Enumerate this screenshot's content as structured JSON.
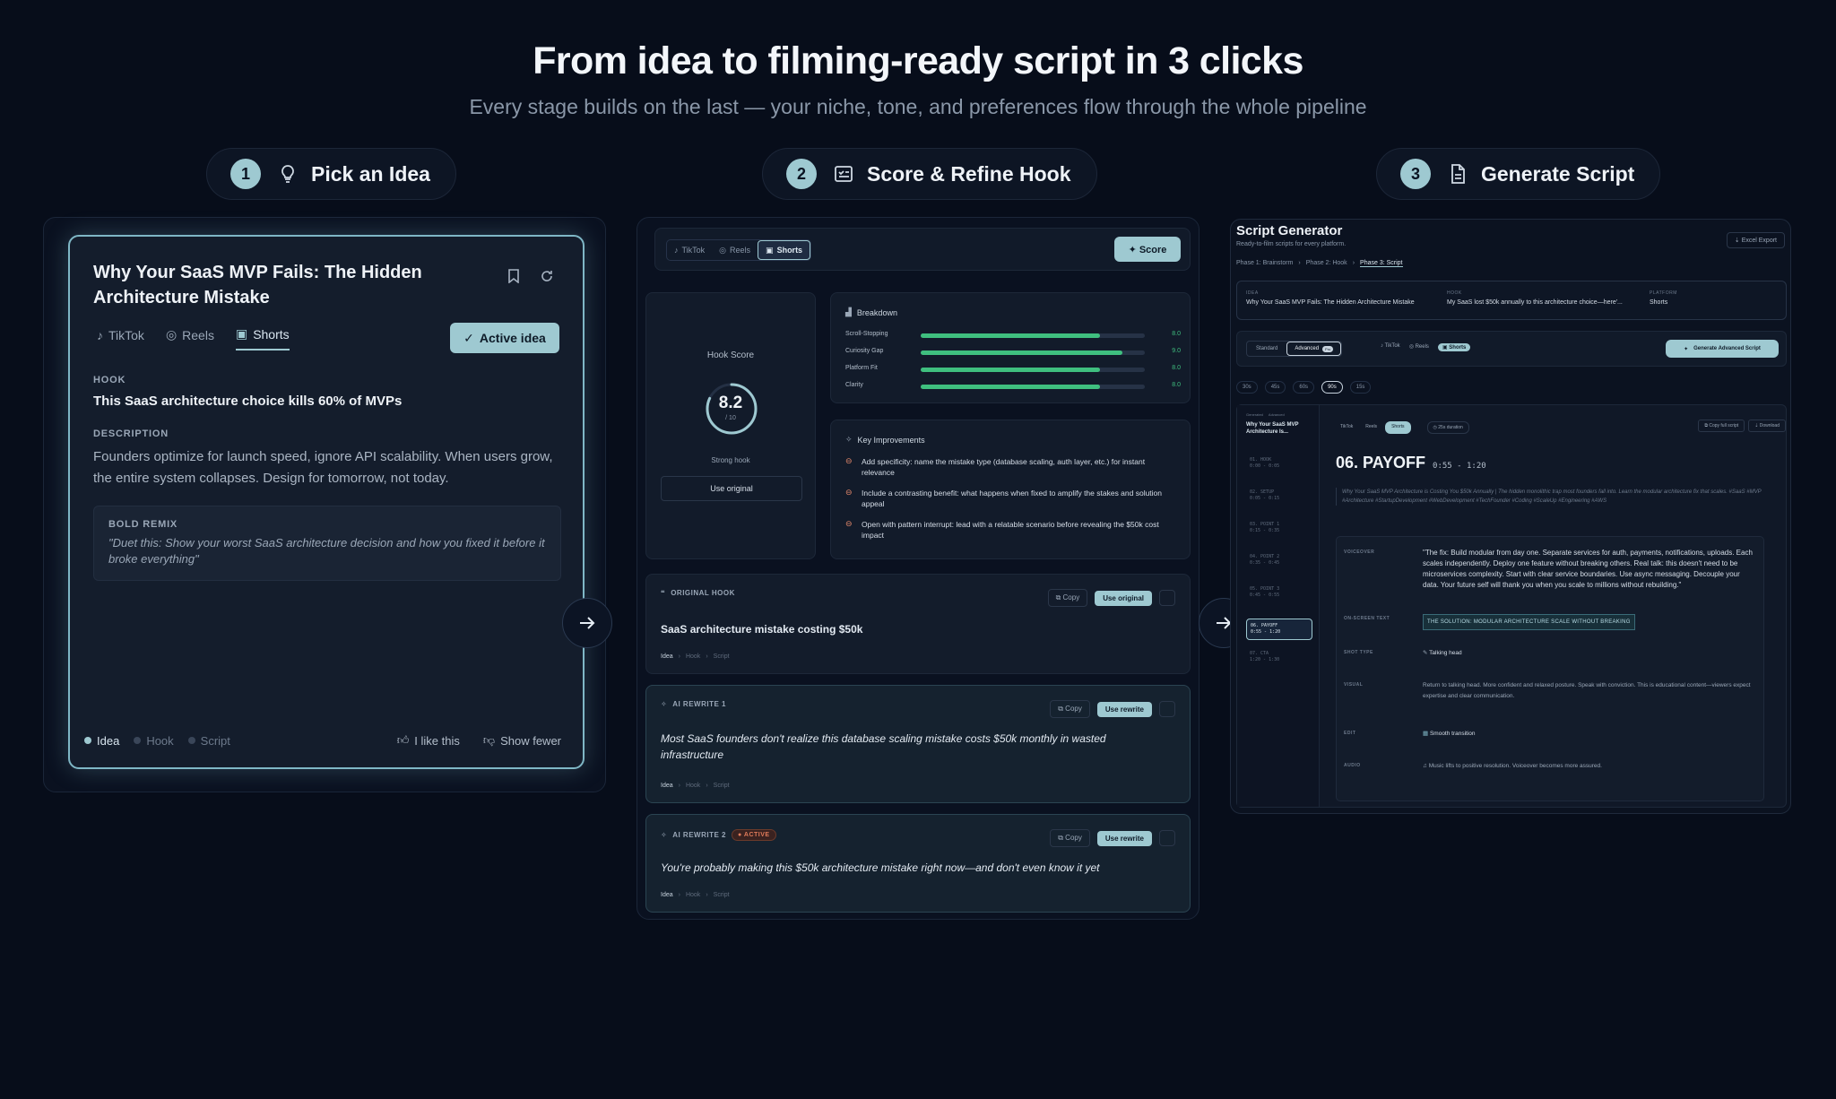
{
  "hero": {
    "title": "From idea to filming-ready script in 3 clicks",
    "subtitle": "Every stage builds on the last — your niche, tone, and preferences flow through the whole pipeline"
  },
  "steps": [
    {
      "num": "1",
      "label": "Pick an Idea",
      "icon": "lightbulb-icon"
    },
    {
      "num": "2",
      "label": "Score & Refine Hook",
      "icon": "checklist-icon"
    },
    {
      "num": "3",
      "label": "Generate Script",
      "icon": "document-icon"
    }
  ],
  "idea_card": {
    "title": "Why Your SaaS MVP Fails: The Hidden Architecture Mistake",
    "tabs": [
      "TikTok",
      "Reels",
      "Shorts"
    ],
    "active_tab": "Shorts",
    "active_button": "Active idea",
    "hook_label": "HOOK",
    "hook": "This SaaS architecture choice kills 60% of MVPs",
    "description_label": "DESCRIPTION",
    "description": "Founders optimize for launch speed, ignore API scalability. When users grow, the entire system collapses. Design for tomorrow, not today.",
    "remix_label": "BOLD REMIX",
    "remix": "\"Duet this: Show your worst SaaS architecture decision and how you fixed it before it broke everything\"",
    "crumbs": [
      "Idea",
      "Hook",
      "Script"
    ],
    "like": "I like this",
    "fewer": "Show fewer"
  },
  "hook_panel": {
    "platforms": [
      "TikTok",
      "Reels",
      "Shorts"
    ],
    "active_platform": "Shorts",
    "score_button": "✦ Score",
    "hook_score_label": "Hook Score",
    "score": "8.2",
    "score_value": 8.2,
    "score_max": "/ 10",
    "score_verdict": "Strong hook",
    "use_original": "Use original",
    "breakdown_title": "Breakdown",
    "breakdown": [
      {
        "label": "Scroll-Stopping",
        "value": "8.0",
        "fill": 0.8
      },
      {
        "label": "Curiosity Gap",
        "value": "9.0",
        "fill": 0.9
      },
      {
        "label": "Platform Fit",
        "value": "8.0",
        "fill": 0.8
      },
      {
        "label": "Clarity",
        "value": "8.0",
        "fill": 0.8
      }
    ],
    "improvements_title": "Key Improvements",
    "improvements": [
      "Add specificity: name the mistake type (database scaling, auth layer, etc.) for instant relevance",
      "Include a contrasting benefit: what happens when fixed to amplify the stakes and solution appeal",
      "Open with pattern interrupt: lead with a relatable scenario before revealing the $50k cost impact"
    ],
    "copy": "Copy",
    "cards": [
      {
        "label": "ORIGINAL HOOK",
        "button": "Use original",
        "text": "SaaS architecture mistake costing $50k",
        "badge": ""
      },
      {
        "label": "AI REWRITE 1",
        "button": "Use rewrite",
        "text": "Most SaaS founders don't realize this database scaling mistake costs $50k monthly in wasted infrastructure",
        "badge": ""
      },
      {
        "label": "AI REWRITE 2",
        "button": "Use rewrite",
        "text": "You're probably making this $50k architecture mistake right now—and don't even know it yet",
        "badge": "● ACTIVE"
      }
    ],
    "crumbs": [
      "Idea",
      "Hook",
      "Script"
    ]
  },
  "script_panel": {
    "title": "Script Generator",
    "subtitle": "Ready-to-film scripts for every platform.",
    "export": "Excel Export",
    "phases": [
      "Phase 1: Brainstorm",
      "Phase 2: Hook",
      "Phase 3: Script"
    ],
    "info": [
      {
        "k": "IDEA",
        "v": "Why Your SaaS MVP Fails: The Hidden Architecture Mistake"
      },
      {
        "k": "HOOK",
        "v": "My SaaS lost $50k annually to this architecture choice—here'..."
      },
      {
        "k": "PLATFORM",
        "v": "Shorts"
      }
    ],
    "modes": [
      "Standard",
      "Advanced"
    ],
    "mode_badge": "Pro",
    "platforms": [
      "TikTok",
      "Reels",
      "Shorts"
    ],
    "generate": "Generate Advanced Script",
    "durations": [
      "30s",
      "45s",
      "60s",
      "90s",
      "15s"
    ],
    "active_duration": "90s",
    "side_meta": [
      "Generated",
      "Advanced"
    ],
    "side_title": "Why Your SaaS MVP Architecture Is...",
    "sections": [
      {
        "name": "01. HOOK",
        "time": "0:00 - 0:05"
      },
      {
        "name": "02. SETUP",
        "time": "0:05 - 0:15"
      },
      {
        "name": "03. POINT 1",
        "time": "0:15 - 0:35"
      },
      {
        "name": "04. POINT 2",
        "time": "0:35 - 0:45"
      },
      {
        "name": "05. POINT 3",
        "time": "0:45 - 0:55"
      },
      {
        "name": "06. PAYOFF",
        "time": "0:55 - 1:20"
      },
      {
        "name": "07. CTA",
        "time": "1:20 - 1:30"
      }
    ],
    "content_tabs": [
      "TikTok",
      "Reels",
      "Shorts"
    ],
    "duration_chip": "25s duration",
    "copy_full": "Copy full script",
    "download": "Download",
    "section_title": "06. PAYOFF",
    "section_time": "0:55 - 1:20",
    "caption": "Why Your SaaS MVP Architecture is Costing You $50k Annually | The hidden monolithic trap most founders fall into. Learn the modular architecture fix that scales. #SaaS #MVP #Architecture #StartupDevelopment #WebDevelopment #TechFounder #Coding #ScaleUp #Engineering #AWS",
    "rows": [
      {
        "k": "VOICEOVER",
        "v": "\"The fix: Build modular from day one. Separate services for auth, payments, notifications, uploads. Each scales independently. Deploy one feature without breaking others. Real talk: this doesn't need to be microservices complexity. Start with clear service boundaries. Use async messaging. Decouple your data. Your future self will thank you when you scale to millions without rebuilding.\""
      },
      {
        "k": "ON-SCREEN TEXT",
        "v": "THE SOLUTION: MODULAR ARCHITECTURE SCALE WITHOUT BREAKING"
      },
      {
        "k": "SHOT TYPE",
        "v": "Talking head"
      },
      {
        "k": "VISUAL",
        "v": "Return to talking head. More confident and relaxed posture. Speak with conviction. This is educational content—viewers expect expertise and clear communication."
      },
      {
        "k": "EDIT",
        "v": "Smooth transition"
      },
      {
        "k": "AUDIO",
        "v": "Music lifts to positive resolution. Voiceover becomes more assured."
      }
    ]
  }
}
